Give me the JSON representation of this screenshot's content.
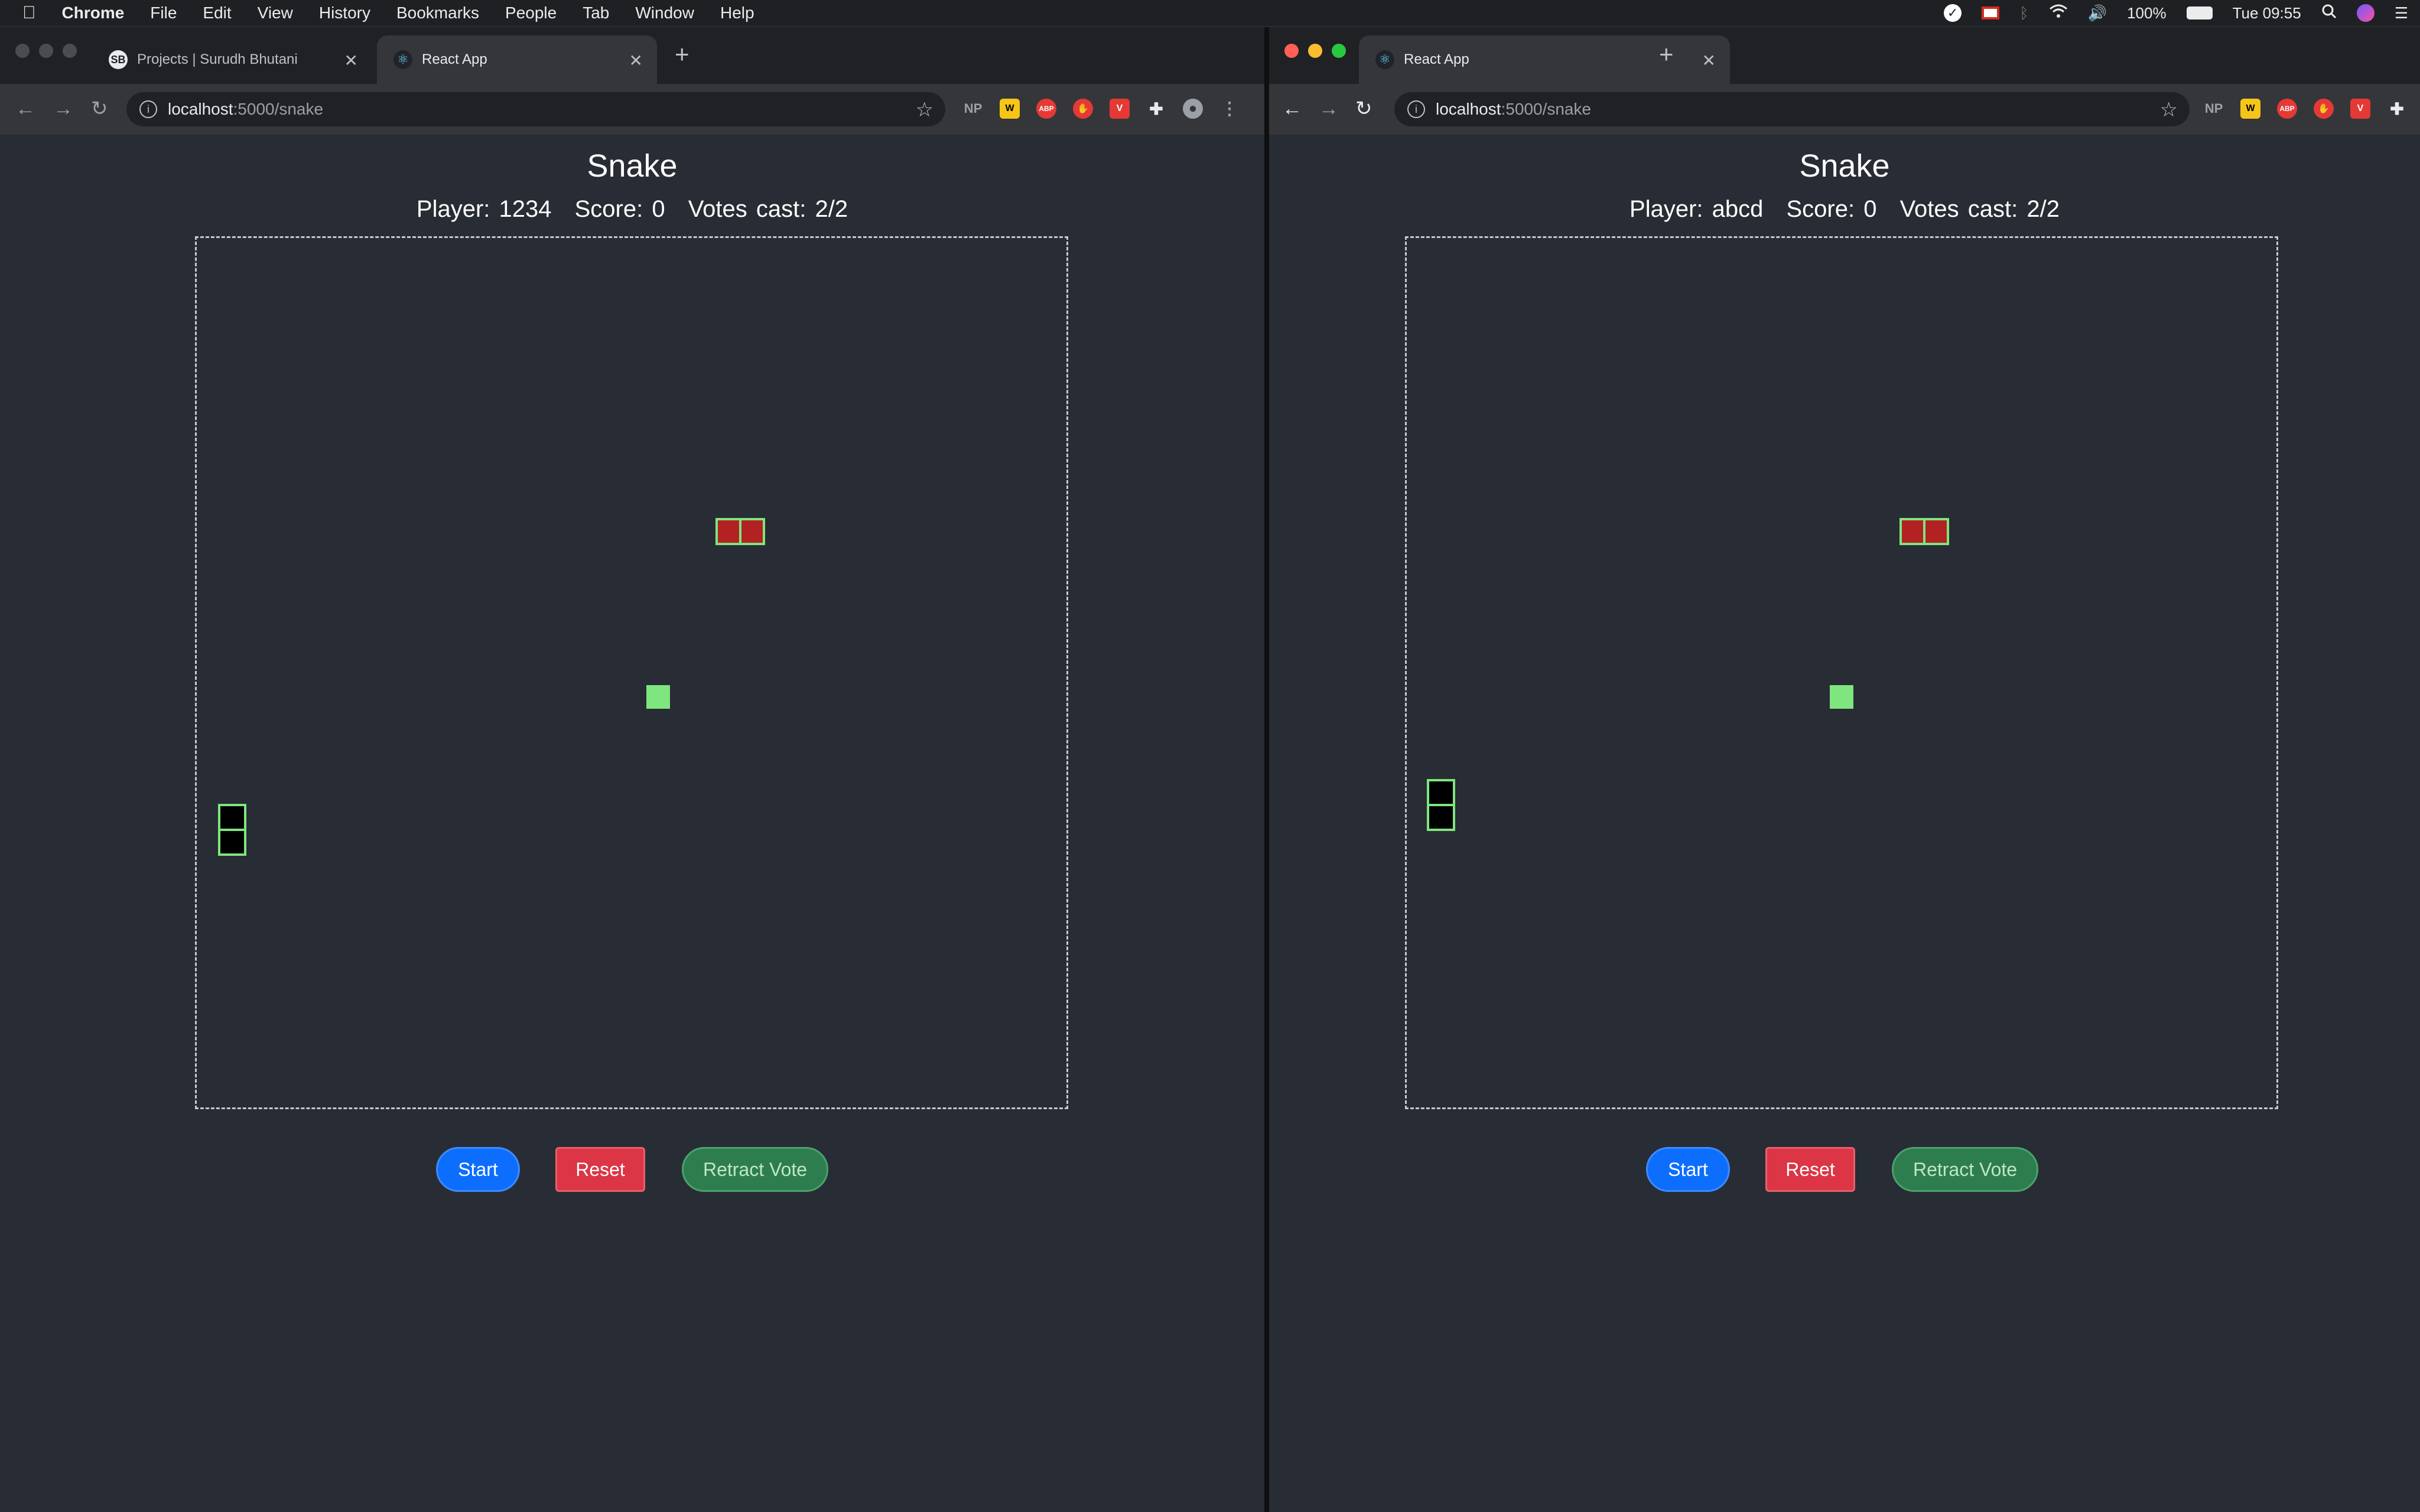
{
  "menubar": {
    "app": "Chrome",
    "items": [
      "File",
      "Edit",
      "View",
      "History",
      "Bookmarks",
      "People",
      "Tab",
      "Window",
      "Help"
    ],
    "battery": "100%",
    "clock": "Tue 09:55"
  },
  "left_window": {
    "tabs": [
      {
        "label": "Projects | Surudh Bhutani",
        "active": false
      },
      {
        "label": "React App",
        "active": true
      }
    ],
    "url_host": "localhost",
    "url_path": ":5000/snake",
    "extensions": [
      "NP",
      "W",
      "ABP",
      "stop",
      "V"
    ],
    "app": {
      "title": "Snake",
      "player_label": "Player: 1234",
      "score_label": "Score: 0",
      "votes_label": "Votes cast: 2/2",
      "buttons": {
        "start": "Start",
        "reset": "Reset",
        "retract": "Retract Vote"
      }
    }
  },
  "right_window": {
    "tabs": [
      {
        "label": "React App",
        "active": true
      }
    ],
    "url_host": "localhost",
    "url_path": ":5000/snake",
    "extensions": [
      "NP",
      "W",
      "ABP",
      "stop",
      "V"
    ],
    "app": {
      "title": "Snake",
      "player_label": "Player: abcd",
      "score_label": "Score: 0",
      "votes_label": "Votes cast: 2/2",
      "buttons": {
        "start": "Start",
        "reset": "Reset",
        "retract": "Retract Vote"
      }
    }
  },
  "colors": {
    "page_bg": "#282c34",
    "snake_border": "#7fe57f",
    "apple_fill": "#b22222",
    "food_fill": "#7fe57f",
    "start": "#0d6efd",
    "reset": "#dc3545",
    "retract": "#2e7d4f"
  }
}
